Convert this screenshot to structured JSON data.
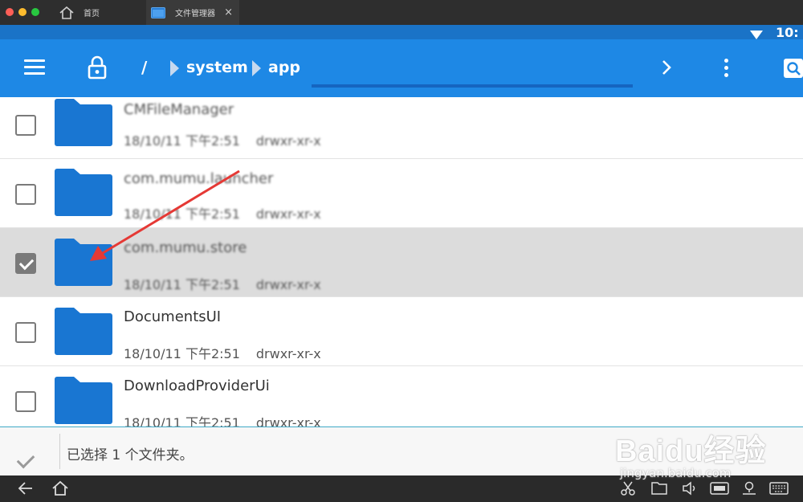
{
  "tabs": [
    {
      "label": "首页",
      "icon": "house-icon"
    },
    {
      "label": "文件管理器",
      "icon": "folder-tab-icon",
      "active": true
    }
  ],
  "status": {
    "time": "10:"
  },
  "toolbar": {
    "breadcrumb_root": "/",
    "breadcrumb": [
      "system",
      "app"
    ]
  },
  "files": [
    {
      "name": "CMFileManager",
      "date": "18/10/11 下午2:51",
      "perm": "drwxr-xr-x",
      "checked": false,
      "blurred": true
    },
    {
      "name": "com.mumu.launcher",
      "date": "18/10/11 下午2:51",
      "perm": "drwxr-xr-x",
      "checked": false,
      "blurred": true
    },
    {
      "name": "com.mumu.store",
      "date": "18/10/11 下午2:51",
      "perm": "drwxr-xr-x",
      "checked": true,
      "blurred": true
    },
    {
      "name": "DocumentsUI",
      "date": "18/10/11 下午2:51",
      "perm": "drwxr-xr-x",
      "checked": false,
      "blurred": false
    },
    {
      "name": "DownloadProviderUi",
      "date": "18/10/11 下午2:51",
      "perm": "drwxr-xr-x",
      "checked": false,
      "blurred": false
    }
  ],
  "selection": {
    "text": "已选择 1 个文件夹。"
  },
  "watermark": {
    "logo": "Baidu经验",
    "sub": "jingyan.baidu.com"
  },
  "colors": {
    "toolbar": "#1e88e5",
    "statusbar": "#1a73c7",
    "folder": "#1976d2",
    "annotation": "#e53935"
  }
}
